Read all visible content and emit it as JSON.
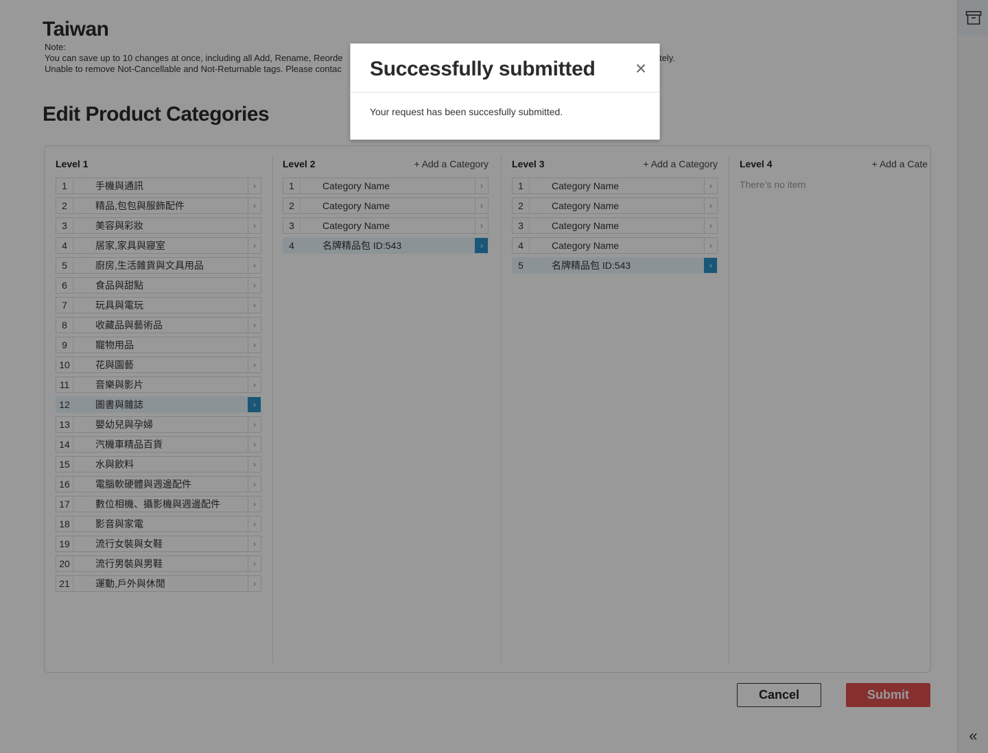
{
  "page": {
    "country": "Taiwan",
    "note_lines": [
      "Note:",
      "You can save up to 10 changes at once, including all Add, Rename, Reorde",
      "Unable to remove Not-Cancellable and Not-Returnable tags. Please contac"
    ],
    "note_tail_visible": "tely.",
    "section_title": "Edit Product Categories"
  },
  "columns": [
    {
      "label": "Level 1",
      "add_label": "",
      "rows": [
        {
          "num": "1",
          "name": "手機與通訊"
        },
        {
          "num": "2",
          "name": "精品,包包與服飾配件"
        },
        {
          "num": "3",
          "name": "美容與彩妝"
        },
        {
          "num": "4",
          "name": "居家,家具與寢室"
        },
        {
          "num": "5",
          "name": "廚房,生活雜貨與文具用品"
        },
        {
          "num": "6",
          "name": "食品與甜點"
        },
        {
          "num": "7",
          "name": "玩具與電玩"
        },
        {
          "num": "8",
          "name": "收藏品與藝術品"
        },
        {
          "num": "9",
          "name": "寵物用品"
        },
        {
          "num": "10",
          "name": "花與園藝"
        },
        {
          "num": "11",
          "name": "音樂與影片"
        },
        {
          "num": "12",
          "name": "圖書與雜誌",
          "active": true
        },
        {
          "num": "13",
          "name": "嬰幼兒與孕婦"
        },
        {
          "num": "14",
          "name": "汽機車精品百貨"
        },
        {
          "num": "15",
          "name": "水與飲料"
        },
        {
          "num": "16",
          "name": "電腦軟硬體與週邊配件"
        },
        {
          "num": "17",
          "name": "數位相機、攝影機與週邊配件"
        },
        {
          "num": "18",
          "name": "影音與家電"
        },
        {
          "num": "19",
          "name": "流行女裝與女鞋"
        },
        {
          "num": "20",
          "name": "流行男裝與男鞋"
        },
        {
          "num": "21",
          "name": "運動,戶外與休閒"
        }
      ]
    },
    {
      "label": "Level 2",
      "add_label": "+ Add a Category",
      "rows": [
        {
          "num": "1",
          "name": "Category Name"
        },
        {
          "num": "2",
          "name": "Category Name"
        },
        {
          "num": "3",
          "name": "Category Name"
        },
        {
          "num": "4",
          "name": "名牌精品包 ID:543",
          "active": true
        }
      ]
    },
    {
      "label": "Level 3",
      "add_label": "+ Add a Category",
      "rows": [
        {
          "num": "1",
          "name": "Category Name"
        },
        {
          "num": "2",
          "name": "Category Name"
        },
        {
          "num": "3",
          "name": "Category Name"
        },
        {
          "num": "4",
          "name": "Category Name"
        },
        {
          "num": "5",
          "name": "名牌精品包 ID:543",
          "active": true
        }
      ]
    },
    {
      "label": "Level 4",
      "add_label": "+ Add a Cate",
      "empty_text": "There’s no item",
      "rows": []
    }
  ],
  "buttons": {
    "cancel": "Cancel",
    "submit": "Submit"
  },
  "rail": {
    "top_icon": "archive-icon",
    "bottom_icon": "double-chevron-left-icon",
    "bottom_glyph": "«"
  },
  "modal": {
    "title": "Successfully submitted",
    "close_glyph": "×",
    "message": "Your request has been succesfully submitted."
  },
  "colors": {
    "accent": "#2a8fc6",
    "submit": "#e05050",
    "active_row": "#eaf5fb"
  }
}
